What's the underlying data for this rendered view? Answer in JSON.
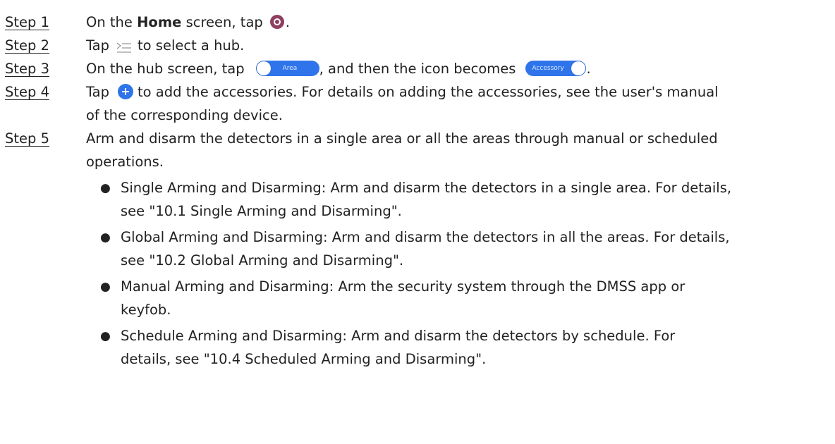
{
  "steps": [
    {
      "label": "Step 1",
      "lines": [
        {
          "pre": "On the ",
          "bold": "Home",
          "post": " screen, tap",
          "icon": "home-icon",
          "after": "."
        }
      ]
    },
    {
      "label": "Step 2",
      "lines": [
        {
          "pre": "Tap",
          "icon": "hub-list-icon",
          "after": "to select a hub."
        }
      ]
    },
    {
      "label": "Step 3",
      "lines": [
        {
          "pre": "On the hub screen, tap",
          "toggle_area_label": "Area",
          "mid": ", and then the icon becomes",
          "toggle_accessory_label": "Accessory",
          "after": "."
        }
      ]
    },
    {
      "label": "Step 4",
      "lines": [
        "Tap",
        "to add the accessories. For details on adding the accessories, see the user's manual",
        "of the corresponding device."
      ]
    },
    {
      "label": "Step 5",
      "lines": [
        "Arm and disarm the detectors in a single area or all the areas through manual or scheduled",
        "operations."
      ],
      "bullets": [
        {
          "lines": [
            "Single Arming and Disarming: Arm and disarm the detectors in a single area. For details,",
            "see \"10.1 Single Arming and Disarming\"."
          ]
        },
        {
          "lines": [
            "Global Arming and Disarming: Arm and disarm the detectors in all the areas. For details,",
            "see \"10.2 Global Arming and Disarming\"."
          ]
        },
        {
          "lines": [
            "Manual Arming and Disarming: Arm the security system through the DMSS app or",
            "keyfob."
          ]
        },
        {
          "lines": [
            "Schedule Arming and Disarming: Arm and disarm the detectors by schedule. For",
            "details, see \"10.4 Scheduled Arming and Disarming\"."
          ]
        }
      ]
    }
  ],
  "bullet_symbol": "●",
  "colors": {
    "text": "#222222",
    "home_icon": "#8e3f60",
    "accent_blue": "#2f74ea",
    "list_icon": "#9a9a9a"
  }
}
